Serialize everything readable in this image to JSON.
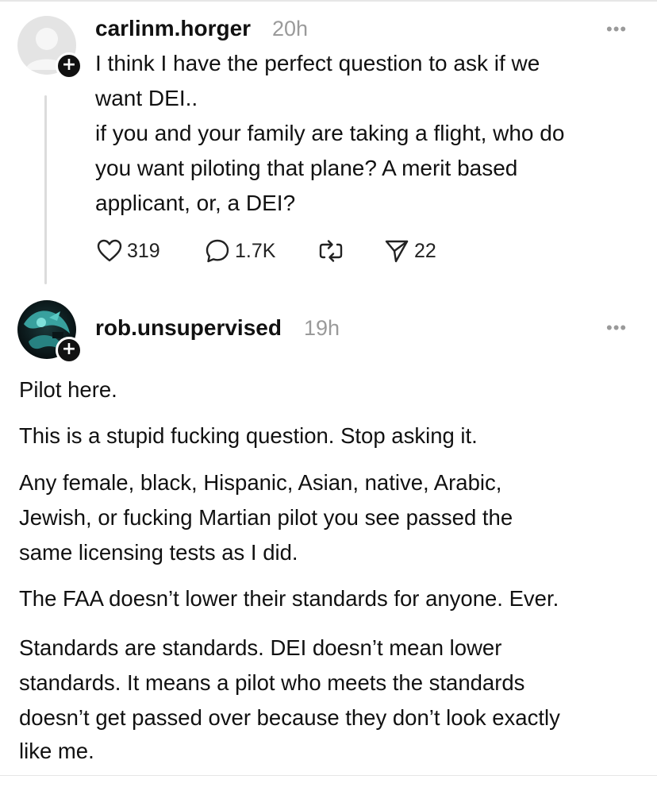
{
  "post": {
    "username": "carlinm.horger",
    "time": "20h",
    "more_icon": "•••",
    "lines": [
      "I think I have the perfect question to ask if we",
      "want DEI..",
      "if you and your family are taking a flight, who do",
      "you want piloting that plane? A merit based",
      "applicant, or, a DEI?"
    ],
    "actions": {
      "likes": "319",
      "replies": "1.7K",
      "shares": "22"
    }
  },
  "reply": {
    "username": "rob.unsupervised",
    "time": "19h",
    "more_icon": "•••",
    "lines": [
      "Pilot here.",
      "This is a stupid fucking question.  Stop asking it.",
      "Any female, black, Hispanic, Asian, native, Arabic,",
      "Jewish, or fucking Martian pilot you see passed the",
      "same licensing tests as I did.",
      "The FAA doesn’t lower their standards for anyone.  Ever.",
      "Standards are standards.  DEI doesn’t mean lower",
      "standards.  It means a pilot who meets the standards",
      "doesn’t get passed over because they don’t look exactly",
      "like me."
    ]
  },
  "icons": {
    "plus_badge": "+"
  }
}
